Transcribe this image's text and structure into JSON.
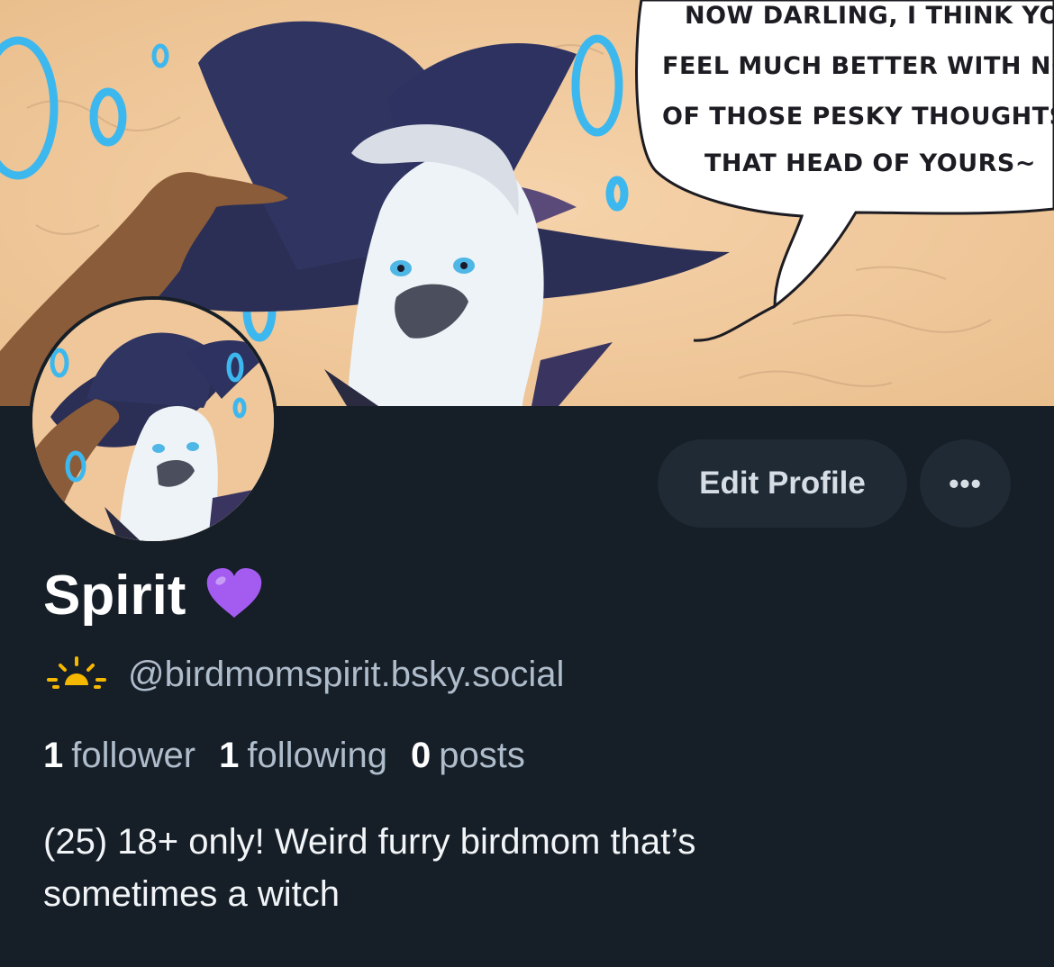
{
  "banner": {
    "speech_bubble_lines": [
      "NOW DARLING, I THINK YOU'D",
      "FEEL MUCH BETTER WITH NON",
      "OF THOSE PESKY THOUGHTS",
      "THAT HEAD OF YOURS~"
    ]
  },
  "profile": {
    "display_name": "Spirit",
    "name_emoji": "purple-heart-icon",
    "handle_icon": "sunrise-icon",
    "handle": "@birdmomspirit.bsky.social",
    "stats": [
      {
        "count": "1",
        "label": "follower"
      },
      {
        "count": "1",
        "label": "following"
      },
      {
        "count": "0",
        "label": "posts"
      }
    ],
    "bio_lines": [
      "(25) 18+ only! Weird furry birdmom that’s",
      "sometimes a witch"
    ]
  },
  "actions": {
    "edit_profile_label": "Edit Profile",
    "more_label": "•••"
  },
  "colors": {
    "background": "#161e27",
    "button_bg": "#1f2a35",
    "secondary_text": "#aebccb",
    "heart": "#a45cf0",
    "sun": "#f5b800"
  }
}
